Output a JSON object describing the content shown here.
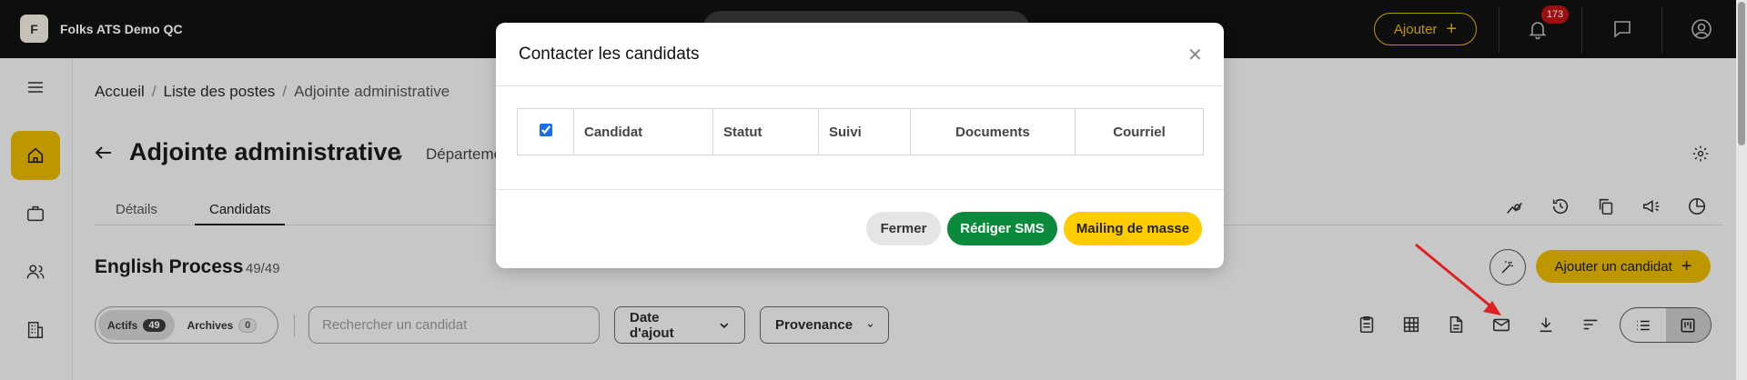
{
  "topbar": {
    "org_initial": "F",
    "org_name": "Folks ATS Demo QC",
    "add_label": "Ajouter",
    "notifications_count": "173"
  },
  "sidebar": {
    "items": [
      {
        "name": "menu-icon"
      },
      {
        "name": "home-icon",
        "active": true
      },
      {
        "name": "briefcase-icon"
      },
      {
        "name": "people-icon"
      },
      {
        "name": "building-icon"
      }
    ]
  },
  "breadcrumb": {
    "home": "Accueil",
    "sep": "/",
    "jobs": "Liste des postes",
    "current": "Adjointe administrative"
  },
  "page": {
    "title": "Adjointe administrative",
    "department": "Départeme"
  },
  "tabs": {
    "details": "Détails",
    "candidates": "Candidats"
  },
  "section": {
    "title": "English Process",
    "count": "49/49",
    "add_candidate": "Ajouter un candidat"
  },
  "filters": {
    "active_label": "Actifs",
    "active_count": "49",
    "archives_label": "Archives",
    "archives_count": "0",
    "search_placeholder": "Rechercher un candidat",
    "date_label": "Date d'ajout",
    "source_label": "Provenance"
  },
  "modal": {
    "title": "Contacter les candidats",
    "columns": [
      "Candidat",
      "Statut",
      "Suivi",
      "Documents",
      "Courriel"
    ],
    "buttons": {
      "close": "Fermer",
      "sms": "Rédiger SMS",
      "mass_mail": "Mailing de masse"
    }
  },
  "colors": {
    "accent": "#e7b800",
    "sms_green": "#0a8a3a",
    "badge_red": "#c01313",
    "annotation_red": "#e02020"
  }
}
